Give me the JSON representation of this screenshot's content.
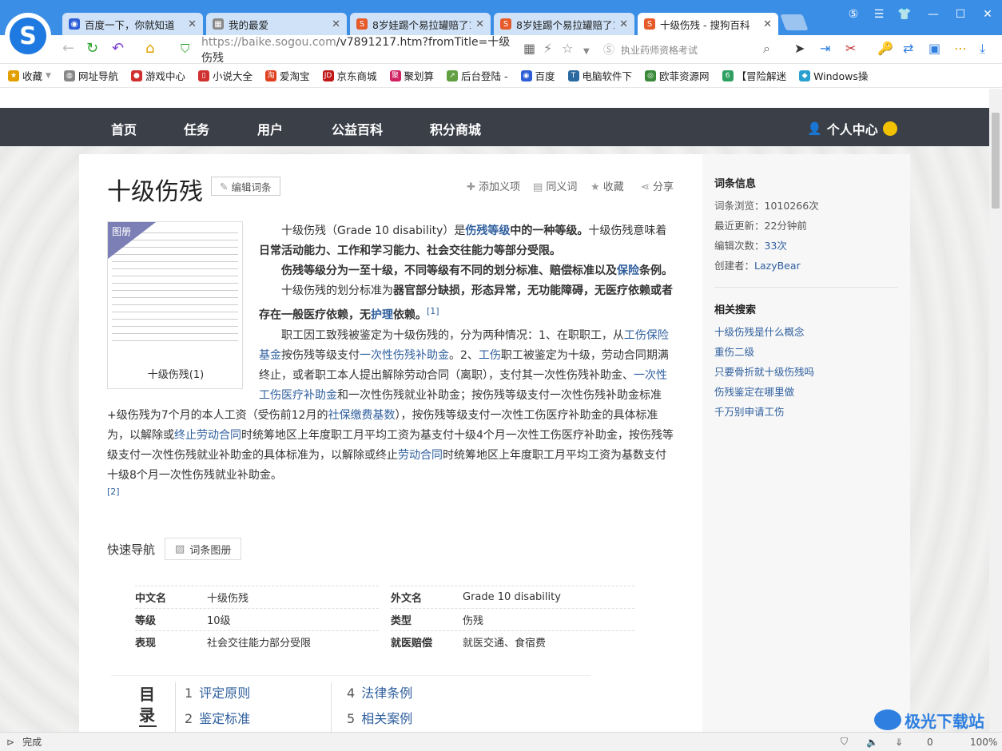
{
  "tabs": [
    {
      "title": "百度一下，你就知道",
      "active": false
    },
    {
      "title": "我的最爱",
      "active": false
    },
    {
      "title": "8岁娃踢个易拉罐赔了1",
      "active": false
    },
    {
      "title": "8岁娃踢个易拉罐赔了1",
      "active": false
    },
    {
      "title": "十级伤残 - 搜狗百科",
      "active": true
    }
  ],
  "address": {
    "url_host": "https://baike.sogou.com",
    "url_path": "/v7891217.htm?fromTitle=十级伤残",
    "search_placeholder": "执业药师资格考试"
  },
  "bookmarks": [
    "收藏",
    "网址导航",
    "游戏中心",
    "小说大全",
    "爱淘宝",
    "京东商城",
    "聚划算",
    "后台登陆 -",
    "百度",
    "电脑软件下",
    "欧菲资源网",
    "【冒险解迷",
    "Windows操"
  ],
  "nav": {
    "items": [
      "首页",
      "任务",
      "用户",
      "公益百科",
      "积分商城"
    ],
    "user_center": "个人中心"
  },
  "article": {
    "title": "十级伤残",
    "edit": "编辑词条",
    "actions": [
      "添加义项",
      "同义词",
      "收藏",
      "分享"
    ],
    "album_badge": "图册",
    "album_caption": "十级伤残(1)",
    "para1_a": "十级伤残（Grade 10 disability）是",
    "para1_link": "伤残等级",
    "para1_b": "中的一种等级。",
    "para1_c": "十级伤残意味着",
    "para1_d": "日常活动能力、工作和学习能力、社会交往能力等部分受限。",
    "para2_a": "伤残等级分为一至十级，不同等级有不同的划分标准、赔偿标准以及",
    "para2_link": "保险",
    "para2_b": "条例。",
    "para3_a": "十级伤残的划分标准为",
    "para3_b": "器官部分缺损，形态异常，无功能障碍，无医疗依赖或者存在一般医疗依赖，无",
    "para3_link": "护理",
    "para3_c": "依赖。",
    "ref1": "[1]",
    "para4_a": "职工因工致残被鉴定为十级伤残的，分为两种情况：1、在职职工，从",
    "para4_l1": "工伤保险基金",
    "para4_b": "按伤残等级支付",
    "para4_l2": "一次性伤残补助金",
    "para4_c": "。2、",
    "para4_l3": "工伤",
    "para4_d": "职工被鉴定为十级，劳动合同期满终止，或者职工本人提出解除劳动合同（离职），支付其一次性伤残补助金、",
    "para4_l4": "一次性工伤医疗补助金",
    "para4_e": "和一次性伤残就业补助金；按伤残等级支付一次性伤残补助金标准+级伤残为7个月的本人工资（受伤前12月的",
    "para4_l5": "社保缴费基数",
    "para4_f": "），按伤残等级支付一次性工伤医疗补助金的具体标准为，以解除或",
    "para4_l6": "终止劳动合同",
    "para4_g": "时统筹地区上年度职工月平均工资为基支付十级4个月一次性工伤医疗补助金，按伤残等级支付一次性伤残就业补助金的具体标准为，以解除或终止",
    "para4_l7": "劳动合同",
    "para4_h": "时统筹地区上年度职工月平均工资为基数支付十级8个月一次性伤残就业补助金。",
    "ref2": "[2]",
    "quick_nav_label": "快速导航",
    "quick_nav_btn": "词条图册",
    "info": [
      {
        "k": "中文名",
        "v": "十级伤残"
      },
      {
        "k": "外文名",
        "v": "Grade 10 disability"
      },
      {
        "k": "等级",
        "v": "10级"
      },
      {
        "k": "类型",
        "v": "伤残"
      },
      {
        "k": "表现",
        "v": "社会交往能力部分受限"
      },
      {
        "k": "就医赔偿",
        "v": "就医交通、食宿费"
      }
    ],
    "toc_heading": "目录",
    "toc": [
      {
        "n": "1",
        "t": "评定原则"
      },
      {
        "n": "2",
        "t": "鉴定标准"
      },
      {
        "n": "4",
        "t": "法律条例"
      },
      {
        "n": "5",
        "t": "相关案例"
      }
    ]
  },
  "sidebar": {
    "info_title": "词条信息",
    "views_label": "词条浏览：",
    "views": "1010266次",
    "updated_label": "最近更新：",
    "updated": "22分钟前",
    "edits_label": "编辑次数：",
    "edits": "33次",
    "creator_label": "创建者：",
    "creator": "LazyBear",
    "related_title": "相关搜索",
    "related": [
      "十级伤残是什么概念",
      "重伤二级",
      "只要骨折就十级伤残吗",
      "伤残鉴定在哪里做",
      "千万别申请工伤"
    ]
  },
  "status": {
    "text": "完成",
    "zoom": "100%",
    "count": "0"
  },
  "watermark": {
    "text": "极光下载站"
  },
  "colors": {
    "titlebar": "#3a8ee6",
    "nav": "#3b3f48",
    "link": "#2f5f9e"
  }
}
